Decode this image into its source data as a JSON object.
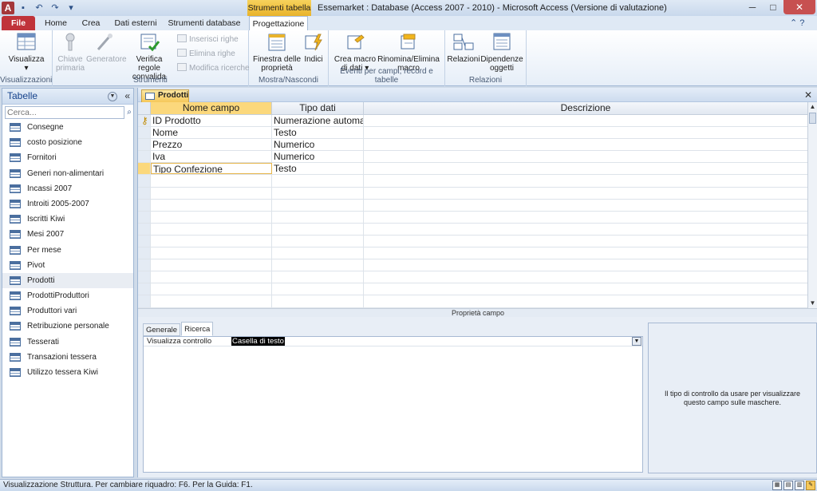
{
  "titlebar": {
    "app_letter": "A",
    "context_tab": "Strumenti tabella",
    "title": "Essemarket : Database (Access 2007 - 2010)  -  Microsoft Access (Versione di valutazione)",
    "controls": {
      "minimize": "─",
      "maximize": "□",
      "close": "✕"
    }
  },
  "tabs": {
    "file": "File",
    "home": "Home",
    "crea": "Crea",
    "dati_esterni": "Dati esterni",
    "strumenti_db": "Strumenti database",
    "progettazione": "Progettazione"
  },
  "ribbon": {
    "visualizzazioni": {
      "label": "Visualizzazioni",
      "visualizza": "Visualizza"
    },
    "strumenti": {
      "label": "Strumenti",
      "chiave_primaria": "Chiave primaria",
      "generatore": "Generatore",
      "verifica": "Verifica regole convalida",
      "inserisci_righe": "Inserisci righe",
      "elimina_righe": "Elimina righe",
      "modifica_ricerche": "Modifica ricerche"
    },
    "mostra": {
      "label": "Mostra/Nascondi",
      "finestra": "Finestra delle proprietà",
      "indici": "Indici"
    },
    "eventi": {
      "label": "Eventi per campi, record e tabelle",
      "crea_macro": "Crea macro di dati",
      "rinomina": "Rinomina/Elimina macro"
    },
    "relazioni": {
      "label": "Relazioni",
      "relazioni_btn": "Relazioni",
      "dipendenze": "Dipendenze oggetti"
    }
  },
  "nav": {
    "title": "Tabelle",
    "search_placeholder": "Cerca...",
    "items": [
      "Consegne",
      "costo posizione",
      "Fornitori",
      "Generi non-alimentari",
      "Incassi 2007",
      "Introiti 2005-2007",
      "Iscritti Kiwi",
      "Mesi 2007",
      "Per mese",
      "Pivot",
      "Prodotti",
      "ProdottiProduttori",
      "Produttori vari",
      "Retribuzione personale",
      "Tesserati",
      "Transazioni tessera",
      "Utilizzo tessera Kiwi"
    ],
    "selected_index": 10
  },
  "document": {
    "tab_label": "Prodotti",
    "columns": [
      "Nome campo",
      "Tipo dati",
      "Descrizione"
    ],
    "rows": [
      {
        "name": "ID Prodotto",
        "type": "Numerazione automatica",
        "desc": ""
      },
      {
        "name": "Nome",
        "type": "Testo",
        "desc": ""
      },
      {
        "name": "Prezzo",
        "type": "Numerico",
        "desc": ""
      },
      {
        "name": "Iva",
        "type": "Numerico",
        "desc": ""
      },
      {
        "name": "Tipo Confezione",
        "type": "Testo",
        "desc": ""
      }
    ],
    "empty_rows": 11,
    "properties_label": "Proprietà campo",
    "ptabs": [
      "Generale",
      "Ricerca"
    ],
    "prop_label": "Visualizza controllo",
    "prop_value": "Casella di testo",
    "help_text": "Il tipo di controllo da usare per visualizzare questo campo sulle maschere."
  },
  "status": {
    "text": "Visualizzazione Struttura.  Per cambiare riquadro: F6.  Per la Guida: F1."
  }
}
